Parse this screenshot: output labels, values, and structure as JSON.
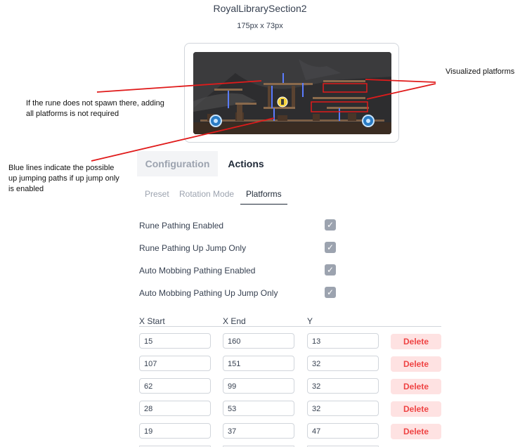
{
  "map": {
    "name": "RoyalLibrarySection2",
    "size": "175px x 73px"
  },
  "annotations": {
    "rune": "If the rune does not spawn there, adding all platforms is not required",
    "blue": "Blue lines indicate the possible up jumping paths if up jump only is enabled",
    "visualized": "Visualized platforms"
  },
  "tabs": [
    "Configuration",
    "Actions"
  ],
  "sub_tabs": [
    "Preset",
    "Rotation Mode",
    "Platforms"
  ],
  "options": [
    {
      "label": "Rune Pathing Enabled",
      "checked": true
    },
    {
      "label": "Rune Pathing Up Jump Only",
      "checked": true
    },
    {
      "label": "Auto Mobbing Pathing Enabled",
      "checked": true
    },
    {
      "label": "Auto Mobbing Pathing Up Jump Only",
      "checked": true
    }
  ],
  "table": {
    "headers": [
      "X Start",
      "X End",
      "Y"
    ],
    "delete_label": "Delete",
    "rows": [
      [
        "15",
        "160",
        "13"
      ],
      [
        "107",
        "151",
        "32"
      ],
      [
        "62",
        "99",
        "32"
      ],
      [
        "28",
        "53",
        "32"
      ],
      [
        "19",
        "37",
        "47"
      ]
    ]
  },
  "colors": {
    "annotation_line": "#e01b1b",
    "jump_path": "#5b7cff",
    "delete_bg": "#fee2e2",
    "delete_text": "#ef4444"
  }
}
